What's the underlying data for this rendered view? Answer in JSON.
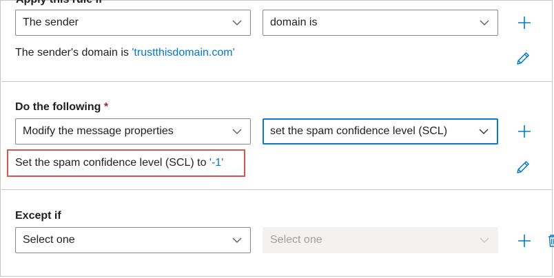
{
  "section_apply": {
    "heading": "Apply this rule if",
    "select_condition": "The sender",
    "select_operator": "domain is",
    "description_prefix": "The sender's domain is ",
    "description_value": "'trustthisdomain.com'"
  },
  "section_do": {
    "heading": "Do the following",
    "required_mark": "*",
    "select_action": "Modify the message properties",
    "select_property": "set the spam confidence level (SCL)",
    "description_prefix": "Set the spam confidence level (SCL) to ",
    "description_value": "'-1'"
  },
  "section_except": {
    "heading": "Except if",
    "select_exception": "Select one",
    "select_exception_value": "Select one"
  },
  "colors": {
    "accent": "#0078d4",
    "highlight_border": "#d9534f",
    "required": "#a4262c"
  },
  "icons": {
    "add": "plus-icon",
    "edit": "pencil-icon",
    "dropdown": "chevron-down-icon",
    "delete": "trash-icon"
  }
}
